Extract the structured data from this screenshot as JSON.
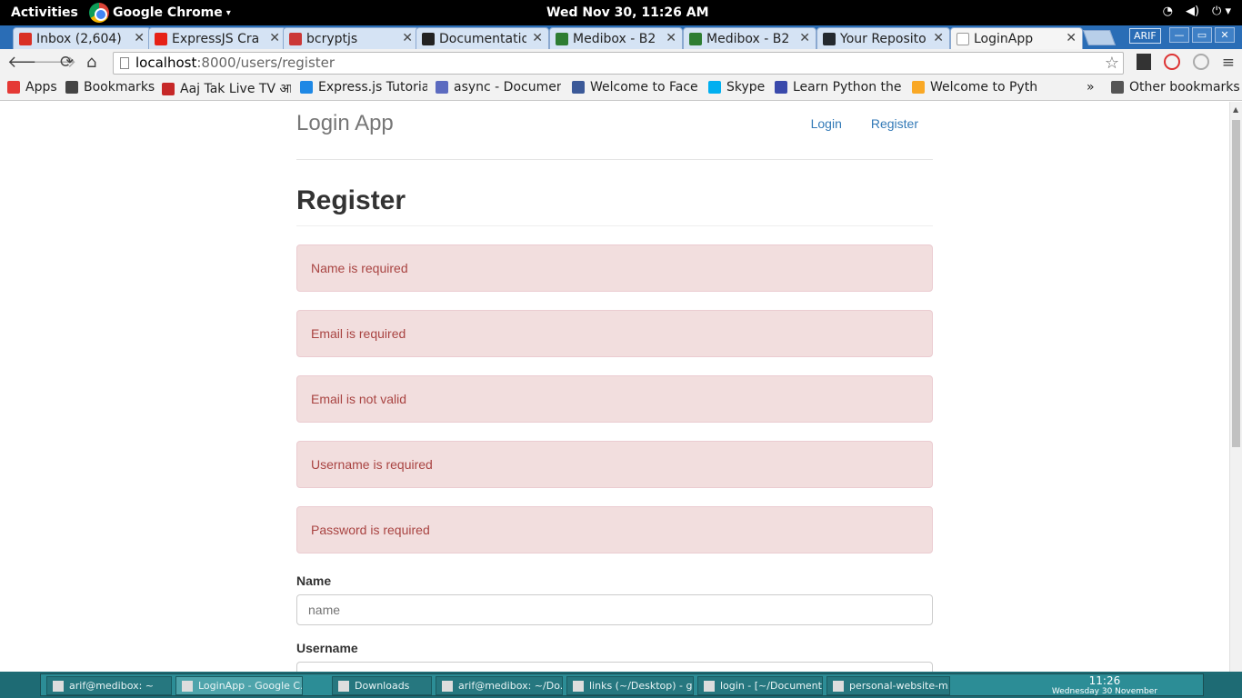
{
  "topbar": {
    "activities": "Activities",
    "app_name": "Google Chrome",
    "app_arrow": "▾",
    "clock": "Wed Nov 30, 11:26 AM",
    "wifi": "wifi-icon",
    "volume": "volume-icon",
    "power": "power-icon",
    "wifi_glyph": "◔",
    "volume_glyph": "◀)",
    "power_glyph": "⏻ ▾"
  },
  "tabs": [
    {
      "label": "Inbox (2,604)",
      "icon_color": "#d93025",
      "active": false
    },
    {
      "label": "ExpressJS Cra",
      "icon_color": "#e62117",
      "active": false
    },
    {
      "label": "bcryptjs",
      "icon_color": "#cb3837",
      "active": false
    },
    {
      "label": "Documentatio",
      "icon_color": "#222222",
      "active": false
    },
    {
      "label": "Medibox - B2",
      "icon_color": "#2e7d32",
      "active": false
    },
    {
      "label": "Medibox - B2",
      "icon_color": "#2e7d32",
      "active": false
    },
    {
      "label": "Your Reposito",
      "icon_color": "#24292e",
      "active": false
    },
    {
      "label": "LoginApp",
      "icon_color": "#ffffff",
      "active": true
    }
  ],
  "tab_close": "✕",
  "profile": "ARIF",
  "window_buttons": [
    "—",
    "▭",
    "✕"
  ],
  "toolbar": {
    "back": "🡐",
    "forward": "🡒",
    "reload": "⟳",
    "home": "⌂",
    "url_host": "localhost",
    "url_path": ":8000/users/register",
    "star": "☆",
    "menu": "≡"
  },
  "bookmarks": [
    {
      "label": "Apps",
      "icon_color": "#e53935"
    },
    {
      "label": "Bookmarks",
      "icon_color": "#444444"
    },
    {
      "label": "Aaj Tak Live TV आ",
      "icon_color": "#c62828"
    },
    {
      "label": "Express.js Tutoria",
      "icon_color": "#1e88e5"
    },
    {
      "label": "async - Documen",
      "icon_color": "#5c6bc0"
    },
    {
      "label": "Welcome to Face",
      "icon_color": "#3b5998"
    },
    {
      "label": "Skype",
      "icon_color": "#00aff0"
    },
    {
      "label": "Learn Python the",
      "icon_color": "#3949ab"
    },
    {
      "label": "Welcome to Pyth",
      "icon_color": "#f9a825"
    }
  ],
  "bookmarks_more": "»",
  "other_bookmarks": "Other bookmarks",
  "page": {
    "brand": "Login App",
    "nav_login": "Login",
    "nav_register": "Register",
    "title": "Register",
    "alerts": [
      "Name is required",
      "Email is required",
      "Email is not valid",
      "Username is required",
      "Password is required"
    ],
    "name_label": "Name",
    "name_placeholder": "name",
    "username_label": "Username"
  },
  "taskbar": {
    "items": [
      {
        "label": "arif@medibox: ~",
        "active": false
      },
      {
        "label": "LoginApp - Google C...",
        "active": true
      },
      {
        "label": "Downloads",
        "active": false
      },
      {
        "label": "arif@medibox: ~/Do...",
        "active": false
      },
      {
        "label": "links (~/Desktop) - g...",
        "active": false
      },
      {
        "label": "login - [~/Document...",
        "active": false
      },
      {
        "label": "personal-website-m...",
        "active": false
      }
    ],
    "time": "11:26",
    "date": "Wednesday 30 November"
  }
}
